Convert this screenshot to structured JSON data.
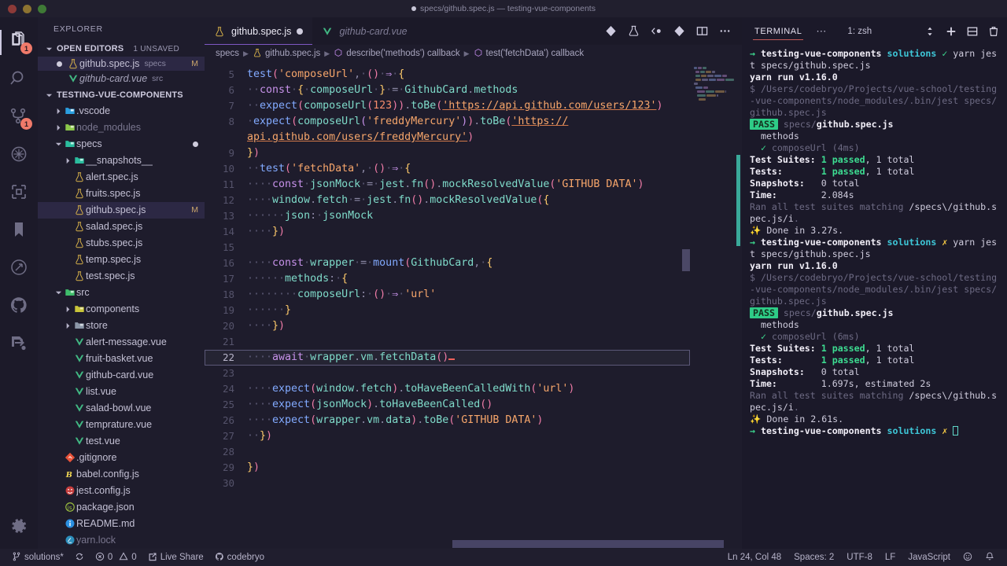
{
  "window": {
    "title": "specs/github.spec.js — testing-vue-components"
  },
  "activitybar": {
    "items": [
      {
        "name": "explorer",
        "icon": "files-icon",
        "badge": "1",
        "active": true
      },
      {
        "name": "search",
        "icon": "search-icon",
        "badge": "",
        "active": false
      },
      {
        "name": "source-control",
        "icon": "source-control-icon",
        "badge": "1",
        "active": false
      },
      {
        "name": "debug",
        "icon": "run-and-debug-icon",
        "badge": "",
        "active": false
      },
      {
        "name": "extensions",
        "icon": "extensions-icon",
        "badge": "",
        "active": false
      },
      {
        "name": "bookmarks",
        "icon": "bookmark-icon",
        "badge": "",
        "active": false
      },
      {
        "name": "gitlens",
        "icon": "gitlens-icon",
        "badge": "",
        "active": false
      },
      {
        "name": "github",
        "icon": "github-icon",
        "badge": "",
        "active": false
      },
      {
        "name": "live-share",
        "icon": "live-share-icon",
        "badge": "",
        "active": false
      }
    ],
    "bottom": {
      "name": "manage",
      "icon": "gear-icon"
    }
  },
  "sidebar": {
    "title": "EXPLORER",
    "open_editors": {
      "label": "OPEN EDITORS",
      "unsaved": "1 UNSAVED",
      "items": [
        {
          "name": "github.spec.js",
          "sub": "specs",
          "status": "M",
          "icon": "jest-icon",
          "dirty": true,
          "selected": true,
          "italic": false
        },
        {
          "name": "github-card.vue",
          "sub": "src",
          "status": "",
          "icon": "vue-icon",
          "dirty": false,
          "selected": false,
          "italic": true
        }
      ]
    },
    "project": {
      "label": "TESTING-VUE-COMPONENTS",
      "tree": [
        {
          "name": ".vscode",
          "type": "folder",
          "icon": "vscode-folder-icon",
          "depth": 1,
          "expanded": false,
          "dim": false
        },
        {
          "name": "node_modules",
          "type": "folder",
          "icon": "node-folder-icon",
          "depth": 1,
          "expanded": false,
          "dim": true
        },
        {
          "name": "specs",
          "type": "folder",
          "icon": "specs-folder-icon",
          "depth": 1,
          "expanded": true,
          "dim": false,
          "dot": true
        },
        {
          "name": "__snapshots__",
          "type": "folder",
          "icon": "snapshots-folder-icon",
          "depth": 2,
          "expanded": false,
          "dim": false
        },
        {
          "name": "alert.spec.js",
          "type": "file",
          "icon": "jest-icon",
          "depth": 2,
          "dim": false
        },
        {
          "name": "fruits.spec.js",
          "type": "file",
          "icon": "jest-icon",
          "depth": 2,
          "dim": false
        },
        {
          "name": "github.spec.js",
          "type": "file",
          "icon": "jest-icon",
          "depth": 2,
          "dim": false,
          "status": "M",
          "selected": true
        },
        {
          "name": "salad.spec.js",
          "type": "file",
          "icon": "jest-icon",
          "depth": 2,
          "dim": false
        },
        {
          "name": "stubs.spec.js",
          "type": "file",
          "icon": "jest-icon",
          "depth": 2,
          "dim": false
        },
        {
          "name": "temp.spec.js",
          "type": "file",
          "icon": "jest-icon",
          "depth": 2,
          "dim": false
        },
        {
          "name": "test.spec.js",
          "type": "file",
          "icon": "jest-icon",
          "depth": 2,
          "dim": false
        },
        {
          "name": "src",
          "type": "folder",
          "icon": "src-folder-icon",
          "depth": 1,
          "expanded": true,
          "dim": false
        },
        {
          "name": "components",
          "type": "folder",
          "icon": "components-folder-icon",
          "depth": 2,
          "expanded": false,
          "dim": false
        },
        {
          "name": "store",
          "type": "folder",
          "icon": "store-folder-icon",
          "depth": 2,
          "expanded": false,
          "dim": false
        },
        {
          "name": "alert-message.vue",
          "type": "file",
          "icon": "vue-icon",
          "depth": 2,
          "dim": false
        },
        {
          "name": "fruit-basket.vue",
          "type": "file",
          "icon": "vue-icon",
          "depth": 2,
          "dim": false
        },
        {
          "name": "github-card.vue",
          "type": "file",
          "icon": "vue-icon",
          "depth": 2,
          "dim": false
        },
        {
          "name": "list.vue",
          "type": "file",
          "icon": "vue-icon",
          "depth": 2,
          "dim": false
        },
        {
          "name": "salad-bowl.vue",
          "type": "file",
          "icon": "vue-icon",
          "depth": 2,
          "dim": false
        },
        {
          "name": "temprature.vue",
          "type": "file",
          "icon": "vue-icon",
          "depth": 2,
          "dim": false
        },
        {
          "name": "test.vue",
          "type": "file",
          "icon": "vue-icon",
          "depth": 2,
          "dim": false
        },
        {
          "name": ".gitignore",
          "type": "file",
          "icon": "git-icon",
          "depth": 1,
          "dim": false
        },
        {
          "name": "babel.config.js",
          "type": "file",
          "icon": "babel-icon",
          "depth": 1,
          "dim": false
        },
        {
          "name": "jest.config.js",
          "type": "file",
          "icon": "jest-config-icon",
          "depth": 1,
          "dim": false
        },
        {
          "name": "package.json",
          "type": "file",
          "icon": "npm-icon",
          "depth": 1,
          "dim": false
        },
        {
          "name": "README.md",
          "type": "file",
          "icon": "readme-icon",
          "depth": 1,
          "dim": false
        },
        {
          "name": "yarn.lock",
          "type": "file",
          "icon": "yarn-icon",
          "depth": 1,
          "dim": true
        }
      ]
    }
  },
  "editor": {
    "tabs": [
      {
        "label": "github.spec.js",
        "icon": "jest-icon",
        "dirty": true,
        "active": true,
        "italic": false
      },
      {
        "label": "github-card.vue",
        "icon": "vue-icon",
        "dirty": false,
        "active": false,
        "italic": true
      }
    ],
    "actions": [
      {
        "name": "split-editor-down-icon"
      },
      {
        "name": "run-tests-icon"
      },
      {
        "name": "toggle-icon"
      },
      {
        "name": "source-control-icon"
      },
      {
        "name": "split-editor-icon"
      },
      {
        "name": "more-actions-icon"
      }
    ],
    "breadcrumb": [
      {
        "label": "specs",
        "icon": ""
      },
      {
        "label": "github.spec.js",
        "icon": "jest-icon"
      },
      {
        "label": "describe('methods') callback",
        "icon": "symbol-icon"
      },
      {
        "label": "test('fetchData') callback",
        "icon": "symbol-icon"
      }
    ],
    "first_line": 5,
    "cursor_line": 22
  },
  "panel": {
    "tab": "TERMINAL",
    "dots": "⋯",
    "shell": "1: zsh",
    "actions": [
      {
        "name": "split-shell-selector-icon"
      },
      {
        "name": "new-terminal-icon"
      },
      {
        "name": "split-terminal-icon"
      },
      {
        "name": "kill-terminal-icon"
      }
    ]
  },
  "statusbar": {
    "left": [
      {
        "name": "branch",
        "icon": "branch-icon",
        "label": "solutions*"
      },
      {
        "name": "sync",
        "icon": "sync-icon",
        "label": ""
      },
      {
        "name": "problems",
        "icon": "errors-icon",
        "label": "0",
        "label2": "0"
      },
      {
        "name": "live-share",
        "icon": "live-share-icon",
        "label": "Live Share"
      },
      {
        "name": "account",
        "icon": "github-icon",
        "label": "codebryo"
      }
    ],
    "right": [
      {
        "name": "cursor-position",
        "label": "Ln 24, Col 48"
      },
      {
        "name": "indentation",
        "label": "Spaces: 2"
      },
      {
        "name": "encoding",
        "label": "UTF-8"
      },
      {
        "name": "eol",
        "label": "LF"
      },
      {
        "name": "language-mode",
        "label": "JavaScript"
      },
      {
        "name": "feedback",
        "icon": "smiley-icon",
        "label": ""
      },
      {
        "name": "notifications",
        "icon": "bell-icon",
        "label": ""
      }
    ]
  },
  "terminal_lines": [
    "→ testing-vue-components solutions ✓ yarn jest specs/github.spec.js",
    "yarn run v1.16.0",
    "$ /Users/codebryo/Projects/vue-school/testing-vue-components/node_modules/.bin/jest specs/github.spec.js",
    "PASS specs/github.spec.js",
    "  methods",
    "    ✓ composeUrl (4ms)",
    "Test Suites: 1 passed, 1 total",
    "Tests:       1 passed, 1 total",
    "Snapshots:   0 total",
    "Time:        2.084s",
    "Ran all test suites matching /specs\\/github.spec.js/i.",
    "✨ Done in 3.27s.",
    "→ testing-vue-components solutions ✗ yarn jest specs/github.spec.js",
    "yarn run v1.16.0",
    "$ /Users/codebryo/Projects/vue-school/testing-vue-components/node_modules/.bin/jest specs/github.spec.js",
    "PASS specs/github.spec.js",
    "  methods",
    "    ✓ composeUrl (6ms)",
    "Test Suites: 1 passed, 1 total",
    "Tests:       1 passed, 1 total",
    "Snapshots:   0 total",
    "Time:        1.697s, estimated 2s",
    "Ran all test suites matching /specs\\/github.spec.js/i.",
    "✨ Done in 2.61s.",
    "→ testing-vue-components solutions ✗ "
  ],
  "code_lines": [
    {
      "n": 5,
      "text": "test('composeUrl', () => {"
    },
    {
      "n": 6,
      "text": "  const { composeUrl } = GithubCard.methods"
    },
    {
      "n": 7,
      "text": "  expect(composeUrl(123)).toBe('https://api.github.com/users/123')"
    },
    {
      "n": 8,
      "text": "  expect(composeUrl('freddyMercury')).toBe('https://api.github.com/users/freddyMercury')"
    },
    {
      "n": 9,
      "text": "})"
    },
    {
      "n": 10,
      "text": "  test('fetchData', () => {"
    },
    {
      "n": 11,
      "text": "    const jsonMock = jest.fn().mockResolvedValue('GITHUB DATA')"
    },
    {
      "n": 12,
      "text": "    window.fetch = jest.fn().mockResolvedValue({"
    },
    {
      "n": 13,
      "text": "      json: jsonMock"
    },
    {
      "n": 14,
      "text": "    })"
    },
    {
      "n": 15,
      "text": ""
    },
    {
      "n": 16,
      "text": "    const wrapper = mount(GithubCard, {"
    },
    {
      "n": 17,
      "text": "      methods: {"
    },
    {
      "n": 18,
      "text": "        composeUrl: () => 'url'"
    },
    {
      "n": 19,
      "text": "      }"
    },
    {
      "n": 20,
      "text": "    })"
    },
    {
      "n": 21,
      "text": ""
    },
    {
      "n": 22,
      "text": "    await wrapper.vm.fetchData()"
    },
    {
      "n": 23,
      "text": ""
    },
    {
      "n": 24,
      "text": "    expect(window.fetch).toHaveBeenCalledWith('url')"
    },
    {
      "n": 25,
      "text": "    expect(jsonMock).toHaveBeenCalled()"
    },
    {
      "n": 26,
      "text": "    expect(wrapper.vm.data).toBe('GITHUB DATA')"
    },
    {
      "n": 27,
      "text": "  })"
    },
    {
      "n": 28,
      "text": ""
    },
    {
      "n": 29,
      "text": "})"
    },
    {
      "n": 30,
      "text": ""
    }
  ],
  "colors": {
    "accent": "#7e57c2",
    "editor_bg": "#1e1c2c",
    "sidebar_bg": "#1e1c2c",
    "pass_badge": "#2ecc87",
    "error_red": "#f0615a",
    "branch_teal": "#3ec7d8",
    "minimap_slider": "#3aa99a"
  }
}
